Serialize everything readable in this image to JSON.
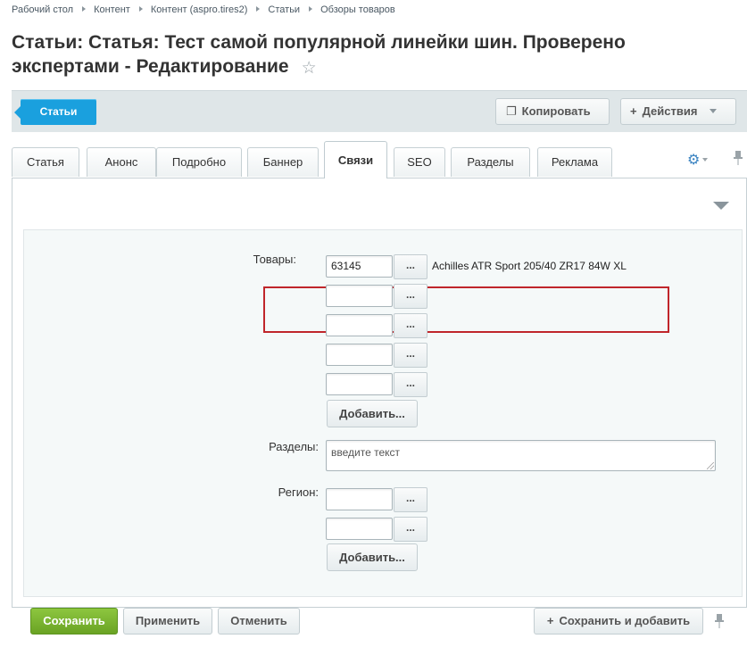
{
  "breadcrumb": [
    "Рабочий стол",
    "Контент",
    "Контент (aspro.tires2)",
    "Статьи",
    "Обзоры товаров"
  ],
  "page": {
    "title": "Статьи: Статья: Тест самой популярной линейки шин. Проверено экспертами - Редактирование",
    "star_icon": "☆"
  },
  "toolbar": {
    "back_label": "Статьи",
    "copy_label": "Копировать",
    "copy_icon": "❐",
    "actions_label": "Действия",
    "actions_icon": "+"
  },
  "tabs": [
    {
      "label": "Статья"
    },
    {
      "label": "Анонс"
    },
    {
      "label": "Подробно"
    },
    {
      "label": "Баннер"
    },
    {
      "label": "Связи",
      "active": true
    },
    {
      "label": "SEO"
    },
    {
      "label": "Разделы"
    },
    {
      "label": "Реклама"
    }
  ],
  "tab_icons": {
    "settings_icon": "⚙",
    "pin_icon": "📌"
  },
  "form": {
    "products": {
      "label": "Товары:",
      "items": [
        {
          "value": "63145",
          "name": "Achilles ATR Sport 205/40 ZR17 84W XL"
        },
        {
          "value": "",
          "name": ""
        },
        {
          "value": "",
          "name": ""
        },
        {
          "value": "",
          "name": ""
        },
        {
          "value": "",
          "name": ""
        }
      ],
      "browse_label": "...",
      "add_label": "Добавить..."
    },
    "sections": {
      "label": "Разделы:",
      "placeholder": "введите текст"
    },
    "region": {
      "label": "Регион:",
      "items": [
        {
          "value": ""
        },
        {
          "value": ""
        }
      ],
      "browse_label": "...",
      "add_label": "Добавить..."
    }
  },
  "bottom": {
    "save_label": "Сохранить",
    "apply_label": "Применить",
    "cancel_label": "Отменить",
    "save_add_label": "Сохранить и добавить",
    "save_add_icon": "+"
  },
  "colors": {
    "accent": "#1aa0de",
    "save_green": "#7cb82f",
    "highlight_red": "#c0262b"
  }
}
